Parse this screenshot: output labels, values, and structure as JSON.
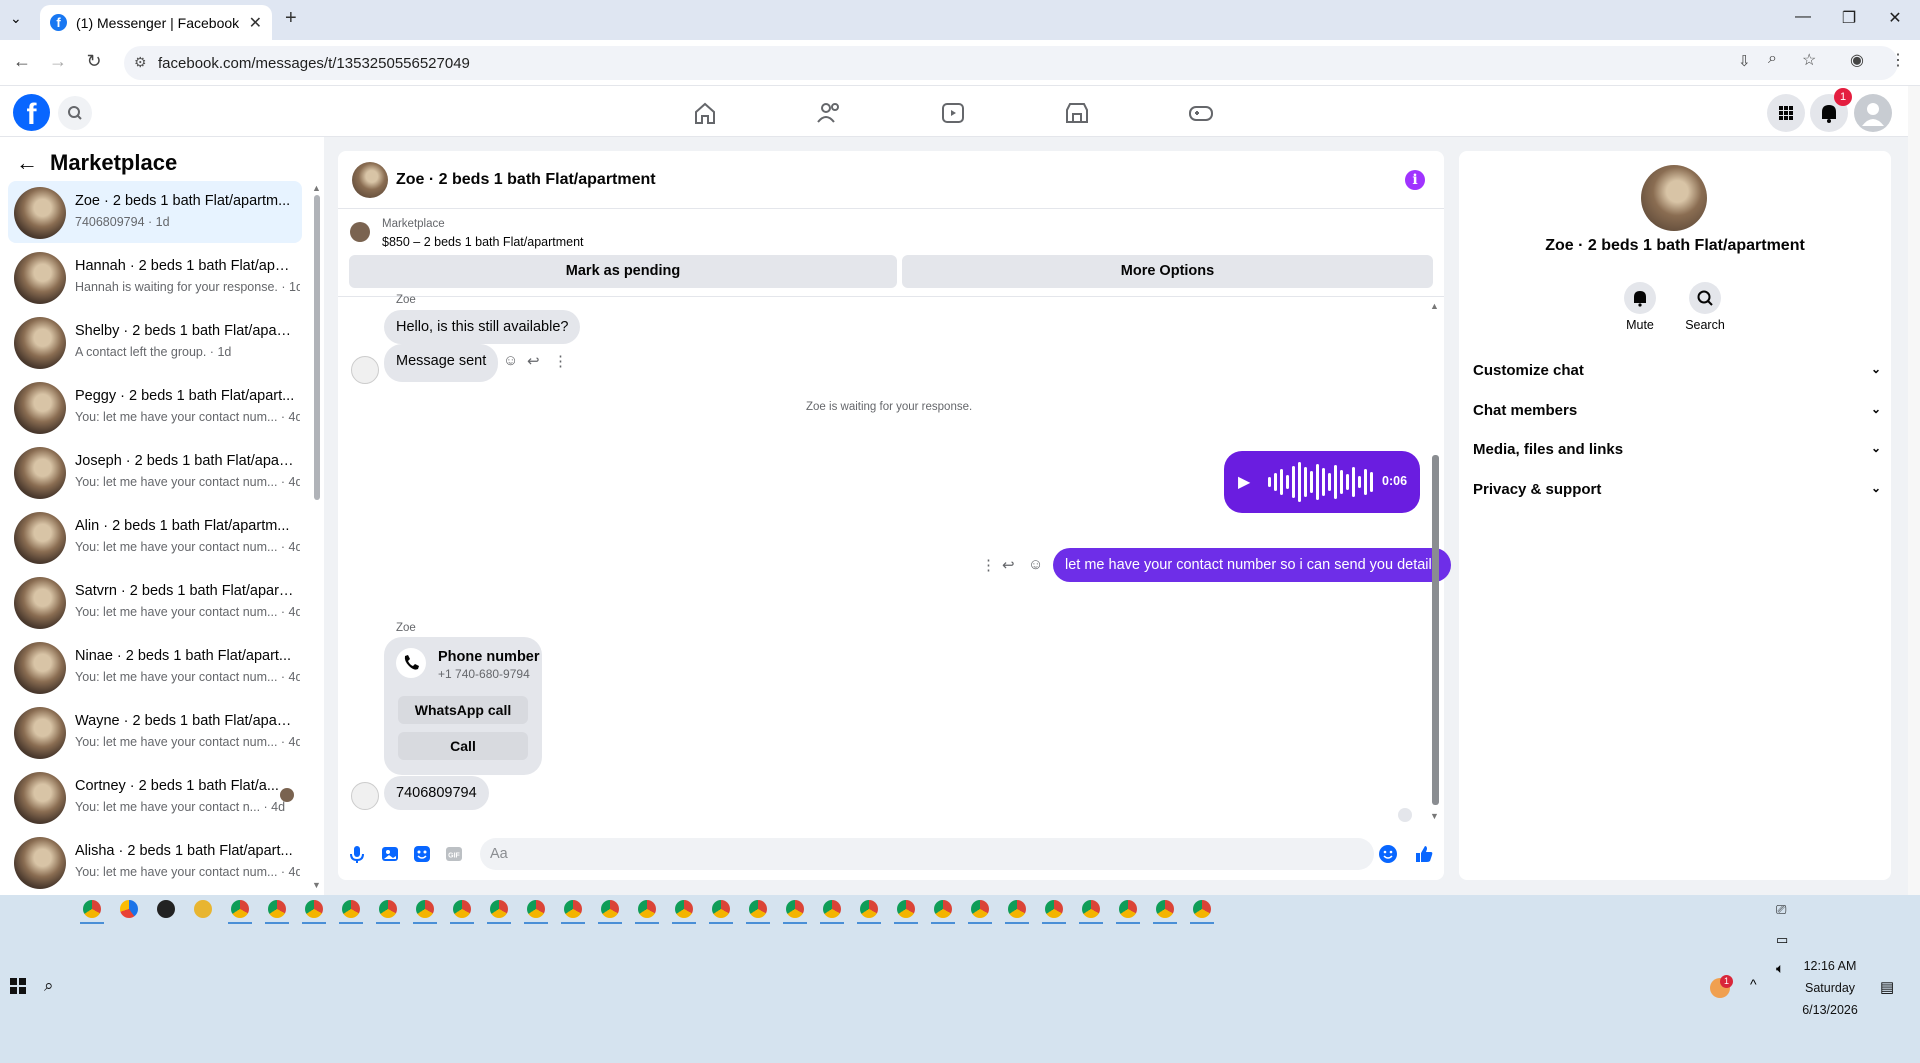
{
  "browser": {
    "tab_title": "(1) Messenger | Facebook",
    "url": "facebook.com/messages/t/1353250556527049"
  },
  "header": {
    "notification_count": "1"
  },
  "sidebar": {
    "title": "Marketplace",
    "conversations": [
      {
        "name": "Zoe · 2 beds 1 bath Flat/apartm...",
        "snippet": "7406809794 · 1d"
      },
      {
        "name": "Hannah · 2 beds 1 bath Flat/apa...",
        "snippet": "Hannah is waiting for your response. · 1d"
      },
      {
        "name": "Shelby · 2 beds 1 bath Flat/apart...",
        "snippet": "A contact left the group. · 1d"
      },
      {
        "name": "Peggy · 2 beds 1 bath Flat/apart...",
        "snippet": "You: let me have your contact num... · 4d"
      },
      {
        "name": "Joseph · 2 beds 1 bath Flat/apar...",
        "snippet": "You: let me have your contact num... · 4d"
      },
      {
        "name": "Alin · 2 beds 1 bath Flat/apartm...",
        "snippet": "You: let me have your contact num... · 4d"
      },
      {
        "name": "Satvrn · 2 beds 1 bath Flat/apart...",
        "snippet": "You: let me have your contact num... · 4d"
      },
      {
        "name": "Ninae · 2 beds 1 bath Flat/apart...",
        "snippet": "You: let me have your contact num... · 4d"
      },
      {
        "name": "Wayne · 2 beds 1 bath Flat/apart...",
        "snippet": "You: let me have your contact num... · 4d"
      },
      {
        "name": "Cortney · 2 beds 1 bath Flat/a...",
        "snippet": "You: let me have your contact n... · 4d"
      },
      {
        "name": "Alisha · 2 beds 1 bath Flat/apart...",
        "snippet": "You: let me have your contact num... · 4d"
      }
    ]
  },
  "chat": {
    "title": "Zoe · 2 beds 1 bath Flat/apartment",
    "marketplace_label": "Marketplace",
    "listing": "$850 – 2 beds 1 bath Flat/apartment",
    "mark_pending": "Mark as pending",
    "more_options": "More Options",
    "sender_top": "Zoe",
    "msg1": "Hello, is this still available?",
    "msg2": "Message sent",
    "waiting": "Zoe is waiting for your response.",
    "voice_duration": "0:06",
    "outgoing": "let me have your contact number so i can send you details",
    "sender2": "Zoe",
    "phone_card_title": "Phone number",
    "phone_card_number": "+1 740-680-9794",
    "whatsapp_call": "WhatsApp call",
    "call": "Call",
    "last_msg": "7406809794",
    "composer_placeholder": "Aa"
  },
  "details": {
    "name": "Zoe · 2 beds 1 bath Flat/apartment",
    "mute": "Mute",
    "search": "Search",
    "sections": [
      "Customize chat",
      "Chat members",
      "Media, files and links",
      "Privacy & support"
    ]
  },
  "taskbar": {
    "time": "12:16 AM",
    "day": "Saturday",
    "date": "6/13/2026",
    "tray_badge": "1"
  },
  "colors": {
    "accent": "#0866ff",
    "outgoing_bubble": "#6e2ee8",
    "info": "#a033ff"
  }
}
